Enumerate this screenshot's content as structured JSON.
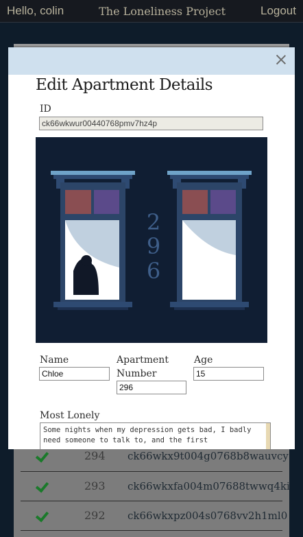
{
  "nav": {
    "greeting": "Hello, colin",
    "title": "The Loneliness Project",
    "logout": "Logout"
  },
  "table": {
    "rows": [
      {
        "number": "294",
        "id": "ck66wkx9t004g0768b8wauvcy"
      },
      {
        "number": "293",
        "id": "ck66wkxfa004m07688twwq4ki"
      },
      {
        "number": "292",
        "id": "ck66wkxpz004s0768vv2h1ml0"
      }
    ]
  },
  "modal": {
    "title": "Edit Apartment Details",
    "id_label": "ID",
    "id_value": "ck66wkwur00440768pmv7hz4p",
    "apartment_graphic_number": "296",
    "name_label": "Name",
    "name_value": "Chloe",
    "apartment_label_line1": "Apartment",
    "apartment_label_line2": "Number",
    "apartment_value": "296",
    "age_label": "Age",
    "age_value": "15",
    "most_lonely_label": "Most Lonely",
    "most_lonely_value": "Some nights when my depression gets bad, I badly need someone to talk to, and the first"
  },
  "colors": {
    "nav_bg": "#16191f",
    "page_bg": "#0e1c2a",
    "modal_header": "#cfe0ee",
    "illustration_bg": "#101e33",
    "check_green": "#1a7a2a"
  }
}
